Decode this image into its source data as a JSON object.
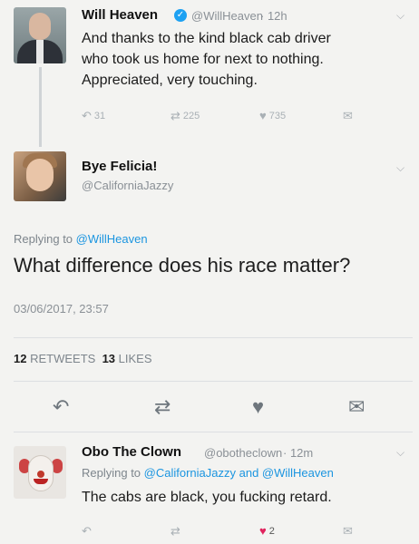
{
  "tweet1": {
    "name": "Will Heaven",
    "handle": "@WillHeaven",
    "time": "· 12h",
    "lines": [
      "And thanks to the kind black cab driver",
      "who took us home for next to nothing.",
      "Appreciated, very touching."
    ],
    "replies": "31",
    "retweets": "225",
    "likes": "735"
  },
  "tweet2": {
    "name": "Bye Felicia!",
    "handle": "@CaliforniaJazzy",
    "replying_prefix": "Replying to ",
    "replying_to": "@WillHeaven",
    "text": "What difference does his race matter?",
    "date": "03/06/2017, 23:57",
    "retweet_count": "12",
    "retweet_label": "RETWEETS",
    "like_count": "13",
    "like_label": "LIKES"
  },
  "tweet3": {
    "name": "Obo The Clown",
    "handle": "@obotheclown",
    "time": "· 12m",
    "replying_prefix": "Replying to ",
    "replying_to": "@CaliforniaJazzy and @WillHeaven",
    "text": "The cabs are black, you fucking retard.",
    "likes": "2"
  },
  "icons": {
    "reply": "reply-icon",
    "retweet": "retweet-icon",
    "like": "heart-icon",
    "dm": "envelope-icon",
    "chevron": "chevron-down-icon",
    "verified": "verified-badge-icon"
  },
  "colors": {
    "link": "#1b95e0",
    "liked": "#e0245e",
    "verified": "#1da1f2"
  }
}
